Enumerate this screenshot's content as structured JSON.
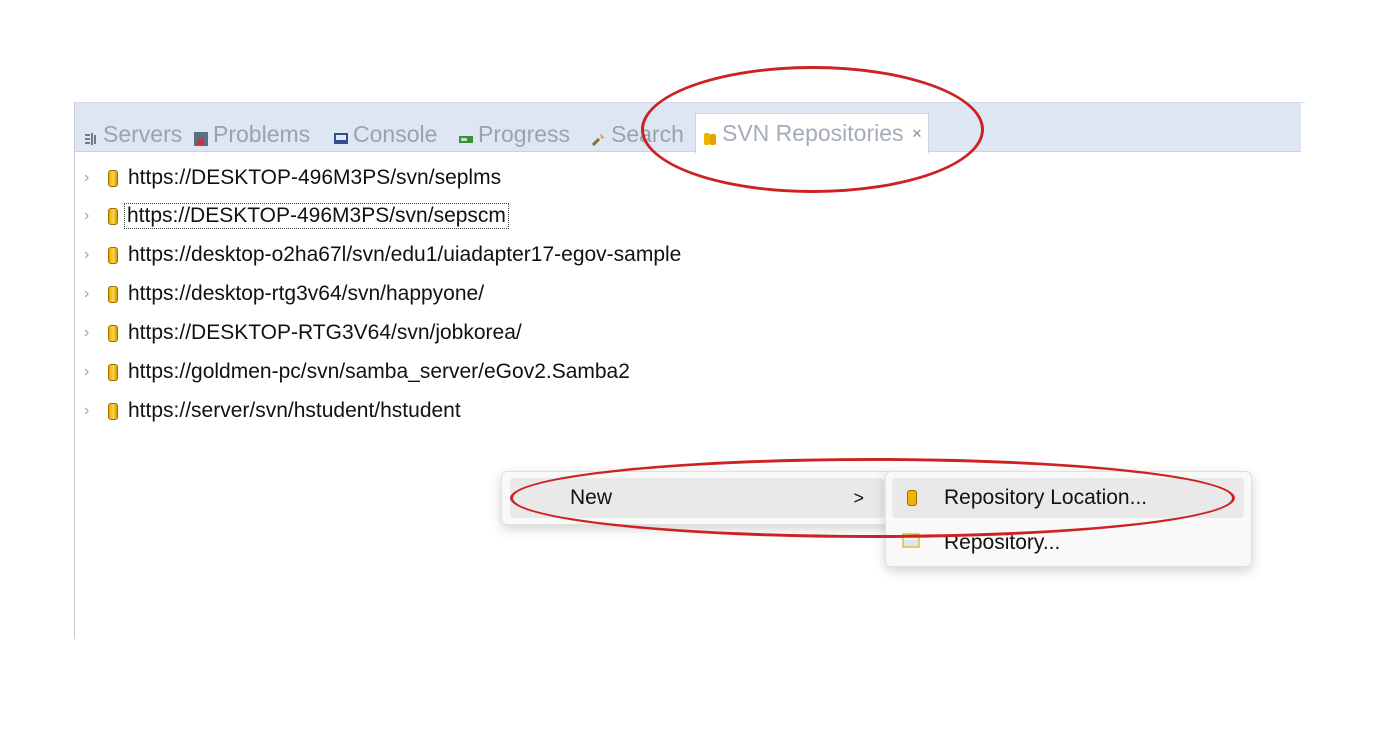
{
  "tabs": [
    {
      "label": "Servers",
      "icon": "servers-icon"
    },
    {
      "label": "Problems",
      "icon": "problems-icon"
    },
    {
      "label": "Console",
      "icon": "console-icon"
    },
    {
      "label": "Progress",
      "icon": "progress-icon"
    },
    {
      "label": "Search",
      "icon": "search-icon"
    },
    {
      "label": "SVN Repositories",
      "icon": "svn-repositories-icon",
      "active": true
    }
  ],
  "close_glyph": "✕",
  "repositories": [
    "https://DESKTOP-496M3PS/svn/seplms",
    "https://DESKTOP-496M3PS/svn/sepscm",
    "https://desktop-o2ha67l/svn/edu1/uiadapter17-egov-sample",
    "https://desktop-rtg3v64/svn/happyone/",
    "https://DESKTOP-RTG3V64/svn/jobkorea/",
    "https://goldmen-pc/svn/samba_server/eGov2.Samba2",
    "https://server/svn/hstudent/hstudent"
  ],
  "context_menu": {
    "new_label": "New",
    "submenu_arrow": ">",
    "submenu": [
      {
        "label": "Repository Location...",
        "icon": "repository-location-icon"
      },
      {
        "label": "Repository...",
        "icon": "svn-repository-icon"
      }
    ]
  },
  "colors": {
    "annotation": "#cc2222",
    "tabbar": "#dde6f2",
    "repo_icon": "#f0b400"
  }
}
